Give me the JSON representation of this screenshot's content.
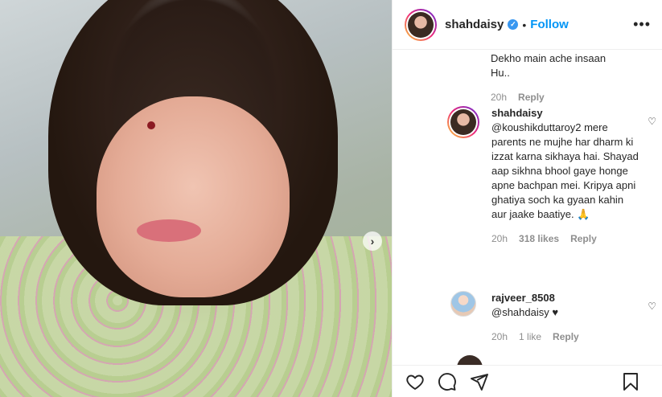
{
  "post": {
    "username": "shahdaisy",
    "follow_label": "Follow",
    "dot": "•",
    "more_glyph": "•••"
  },
  "truncated_comment": {
    "text_line1": "Dekho main ache insaan",
    "text_line2": "Hu..",
    "time": "20h",
    "reply": "Reply"
  },
  "comments": [
    {
      "username": "shahdaisy",
      "text": "@koushikduttaroy2 mere parents ne mujhe har dharm ki izzat karna sikhaya hai. Shayad aap sikhna bhool gaye honge apne bachpan mei. Kripya apni ghatiya soch ka gyaan kahin aur jaake baatiye. 🙏",
      "time": "20h",
      "likes": "318 likes",
      "reply": "Reply"
    },
    {
      "username": "rajveer_8508",
      "text": "@shahdaisy ♥",
      "time": "20h",
      "likes": "1 like",
      "reply": "Reply"
    }
  ],
  "icons": {
    "heart": "like-icon",
    "comment": "comment-icon",
    "share": "share-icon",
    "save": "save-icon"
  }
}
